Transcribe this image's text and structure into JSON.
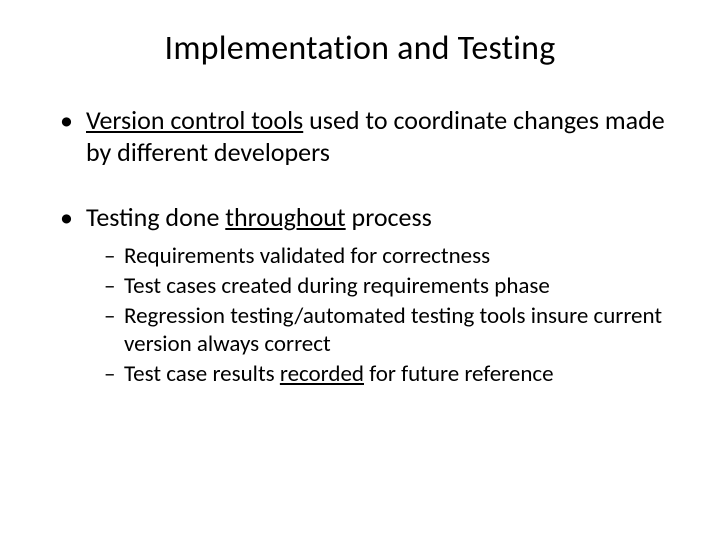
{
  "title": "Implementation and Testing",
  "b1": {
    "u1": "Version control tools",
    "rest": " used to coordinate changes made by different developers"
  },
  "b2": {
    "pre": "Testing done ",
    "u": "throughout",
    "post": " process",
    "s1": "Requirements validated for correctness",
    "s2": "Test cases created during requirements phase",
    "s3": "Regression testing/automated testing tools insure current version always correct",
    "s4pre": "Test case results ",
    "s4u": "recorded",
    "s4post": " for future reference"
  }
}
